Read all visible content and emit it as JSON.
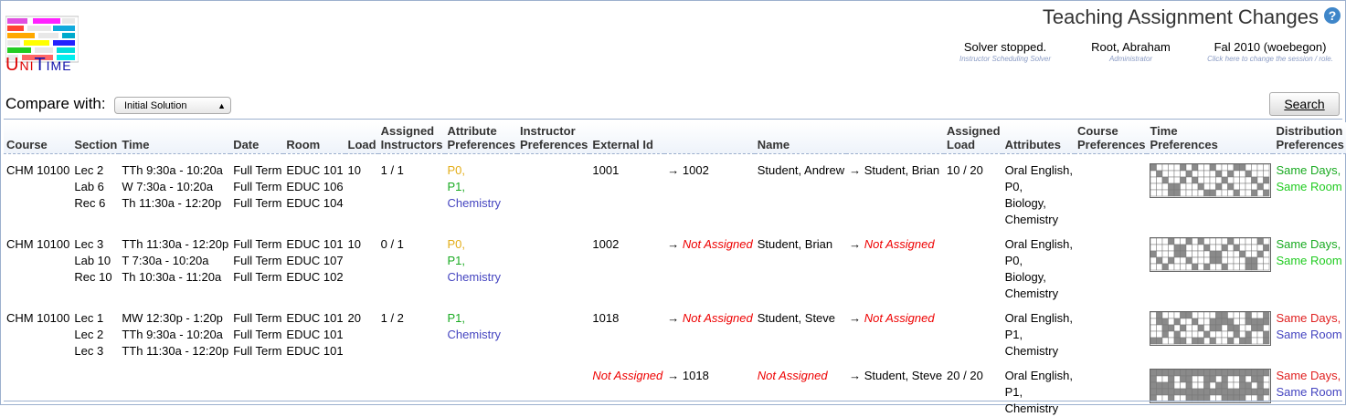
{
  "app": {
    "logo_text": "UniTime",
    "title": "Teaching Assignment Changes",
    "help_label": "?"
  },
  "status": {
    "solver": {
      "main": "Solver stopped.",
      "sub": "Instructor Scheduling Solver"
    },
    "user": {
      "main": "Root, Abraham",
      "sub": "Administrator"
    },
    "session": {
      "main": "Fal 2010 (woebegon)",
      "sub": "Click here to change the session / role."
    }
  },
  "compare": {
    "label": "Compare with:",
    "selected": "Initial Solution"
  },
  "search_label": "Search",
  "table": {
    "headers": {
      "course": "Course",
      "section": "Section",
      "time": "Time",
      "date": "Date",
      "room": "Room",
      "load": "Load",
      "assigned_instructors": [
        "Assigned",
        "Instructors"
      ],
      "attribute_prefs": [
        "Attribute",
        "Preferences"
      ],
      "instructor_prefs": [
        "Instructor",
        "Preferences"
      ],
      "external_id": "External Id",
      "name": "Name",
      "assigned_load": [
        "Assigned",
        "Load"
      ],
      "attributes": "Attributes",
      "course_prefs": [
        "Course",
        "Preferences"
      ],
      "time_prefs": [
        "Time",
        "Preferences"
      ],
      "distribution_prefs": [
        "Distribution",
        "Preferences"
      ]
    },
    "arrow": "→",
    "rows": [
      {
        "course": "CHM 10100",
        "sections": [
          "Lec 2",
          "Lab 6",
          "Rec 6"
        ],
        "times": [
          "TTh 9:30a - 10:20a",
          "W 7:30a - 10:20a",
          "Th 11:30a - 12:20p"
        ],
        "dates": [
          "Full Term",
          "Full Term",
          "Full Term"
        ],
        "rooms": [
          "EDUC 101",
          "EDUC 106",
          "EDUC 104"
        ],
        "load": "10",
        "assigned": "1 / 1",
        "attr_prefs": [
          "P0,",
          "P1,",
          "Chemistry"
        ],
        "ext_old": "1001",
        "ext_new": "1002",
        "name_old": "Student, Andrew",
        "name_new": "Student, Brian",
        "assigned_load": "10 / 20",
        "attributes": [
          "Oral English,",
          "P0,",
          "Biology,",
          "Chemistry"
        ],
        "dist_prefs": [
          "Same Days,",
          "Same Room"
        ]
      },
      {
        "course": "CHM 10100",
        "sections": [
          "Lec 3",
          "Lab 10",
          "Rec 10"
        ],
        "times": [
          "TTh 11:30a - 12:20p",
          "T 7:30a - 10:20a",
          "Th 10:30a - 11:20a"
        ],
        "dates": [
          "Full Term",
          "Full Term",
          "Full Term"
        ],
        "rooms": [
          "EDUC 101",
          "EDUC 107",
          "EDUC 102"
        ],
        "load": "10",
        "assigned": "0 / 1",
        "attr_prefs": [
          "P0,",
          "P1,",
          "Chemistry"
        ],
        "ext_old": "1002",
        "ext_new": "Not Assigned",
        "name_old": "Student, Brian",
        "name_new": "Not Assigned",
        "assigned_load": "",
        "attributes": [
          "Oral English,",
          "P0,",
          "Biology,",
          "Chemistry"
        ],
        "dist_prefs": [
          "Same Days,",
          "Same Room"
        ]
      },
      {
        "course": "CHM 10100",
        "sections": [
          "Lec 1",
          "Lec 2",
          "Lec 3"
        ],
        "times": [
          "MW 12:30p - 1:20p",
          "TTh 9:30a - 10:20a",
          "TTh 11:30a - 12:20p"
        ],
        "dates": [
          "Full Term",
          "Full Term",
          "Full Term"
        ],
        "rooms": [
          "EDUC 101",
          "EDUC 101",
          "EDUC 101"
        ],
        "load": "20",
        "assigned": "1 / 2",
        "attr_prefs": [
          "P1,",
          "Chemistry"
        ],
        "ext_old": "1018",
        "ext_new": "Not Assigned",
        "name_old": "Student, Steve",
        "name_new": "Not Assigned",
        "assigned_load": "",
        "attributes": [
          "Oral English,",
          "P1,",
          "Chemistry"
        ],
        "dist_prefs": [
          "Same Days,",
          "Same Room"
        ]
      },
      {
        "ext_old": "Not Assigned",
        "ext_new": "1018",
        "name_old": "Not Assigned",
        "name_new": "Student, Steve",
        "assigned_load": "20 / 20",
        "attributes": [
          "Oral English,",
          "P1,",
          "Chemistry"
        ],
        "dist_prefs": [
          "Same Days,",
          "Same Room"
        ]
      }
    ]
  },
  "colors": {
    "pref_p0": "#e3ad18",
    "pref_p1": "#1aab22",
    "pref_chem": "#4545c0",
    "not_assigned": "#e00000",
    "same_days_green": "#22cc22",
    "same_days_red": "#e02020",
    "same_room_blue": "#4545c0",
    "border": "#9cb0ce"
  },
  "icons": {
    "help": "help-circle-icon",
    "logo": "unitime-logo",
    "select_chevron": "chevron-updown-icon"
  }
}
